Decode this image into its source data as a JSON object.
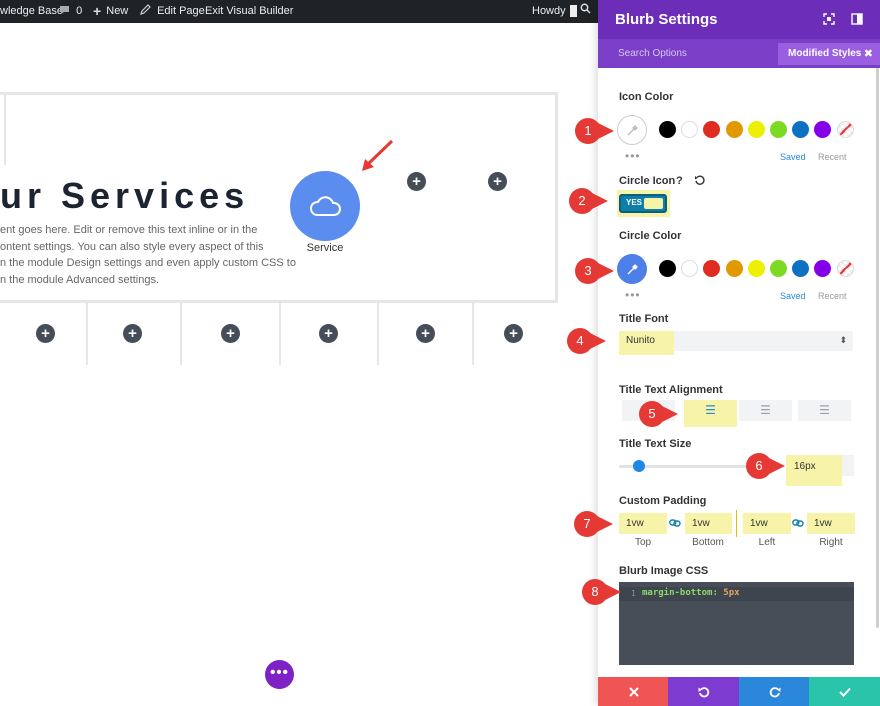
{
  "admin_bar": {
    "site_label": "wledge Base",
    "comments_count": "0",
    "new_label": "New",
    "edit_page_label": "Edit Page",
    "exit_vb_label": "Exit Visual Builder",
    "howdy_label": "Howdy"
  },
  "canvas": {
    "heading": "ur Services",
    "body_lines": [
      "ent goes here. Edit or remove this text inline or in the",
      "ontent settings. You can also style every aspect of this",
      "n the module Design settings and even apply custom CSS to",
      "n the module Advanced settings."
    ],
    "blurb_title": "Service",
    "blurb_icon": "cloud-icon",
    "blurb_color": "#5b8def",
    "more_label": "•••",
    "plus_label": "+"
  },
  "panel": {
    "title": "Blurb Settings",
    "search_options": "Search Options",
    "modified_styles": "Modified Styles",
    "accent": "#6c2eb9",
    "icon_color": {
      "label": "Icon Color",
      "swatches": [
        "#000000",
        "#ffffff",
        "#e02b20",
        "#e09900",
        "#edf000",
        "#7cda24",
        "#0c71c3",
        "#8300e9"
      ],
      "saved": "Saved",
      "recent": "Recent"
    },
    "circle_icon": {
      "label": "Circle Icon",
      "help": "?",
      "toggle_label": "YES"
    },
    "circle_color": {
      "label": "Circle Color",
      "swatches": [
        "#000000",
        "#ffffff",
        "#e02b20",
        "#e09900",
        "#edf000",
        "#7cda24",
        "#0c71c3",
        "#8300e9"
      ],
      "saved": "Saved",
      "recent": "Recent"
    },
    "title_font": {
      "label": "Title Font",
      "value": "Nunito"
    },
    "title_text_alignment": {
      "label": "Title Text Alignment"
    },
    "title_text_size": {
      "label": "Title Text Size",
      "value": "16px",
      "slider_fraction": 0.16
    },
    "custom_padding": {
      "label": "Custom Padding",
      "top": "1vw",
      "bottom": "1vw",
      "left": "1vw",
      "right": "1vw",
      "top_label": "Top",
      "bottom_label": "Bottom",
      "left_label": "Left",
      "right_label": "Right"
    },
    "blurb_image_css": {
      "label": "Blurb Image CSS",
      "line_number": "1",
      "property": "margin-bottom:",
      "value": "5px"
    },
    "footer_colors": [
      "#ef5555",
      "#7e3bd0",
      "#2b87da",
      "#29c4a9"
    ]
  },
  "callouts": [
    "1",
    "2",
    "3",
    "4",
    "5",
    "6",
    "7",
    "8"
  ]
}
